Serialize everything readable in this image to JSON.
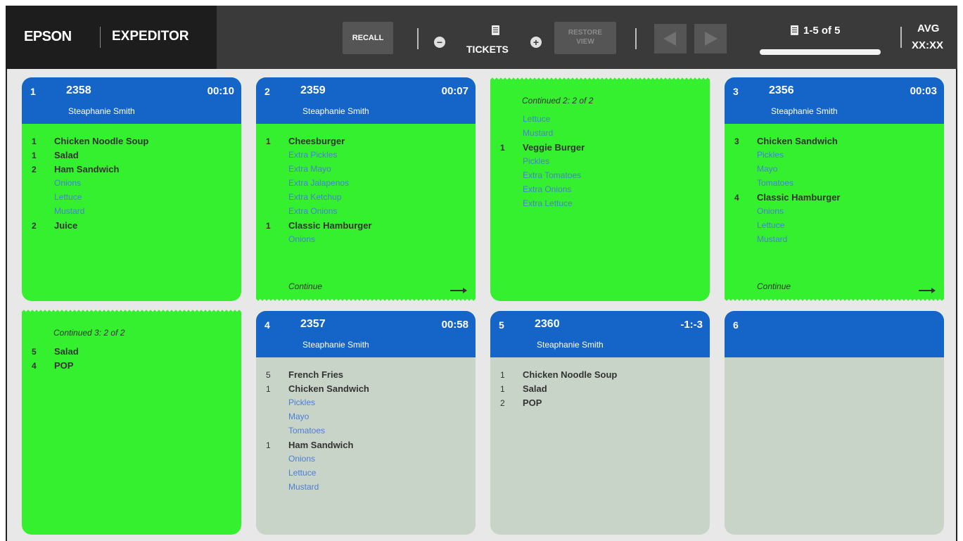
{
  "header": {
    "brand": "EPSON",
    "app_title": "EXPEDITOR",
    "recall_label": "RECALL",
    "tickets_label": "TICKETS",
    "restore_label_1": "RESTORE",
    "restore_label_2": "VIEW",
    "page_label": "1-5 of 5",
    "avg_label": "AVG",
    "avg_value": "XX:XX",
    "page_progress": 1.0
  },
  "tickets": {
    "t1": {
      "num": "1",
      "id": "2358",
      "time": "00:10",
      "name": "Steaphanie Smith",
      "items": [
        {
          "qty": "1",
          "name": "Chicken Noodle Soup",
          "mods": []
        },
        {
          "qty": "1",
          "name": "Salad",
          "mods": []
        },
        {
          "qty": "2",
          "name": "Ham Sandwich",
          "mods": [
            "Onions",
            "Lettuce",
            "Mustard"
          ]
        },
        {
          "qty": "2",
          "name": "Juice",
          "mods": []
        }
      ]
    },
    "t2": {
      "num": "2",
      "id": "2359",
      "time": "00:07",
      "name": "Steaphanie Smith",
      "items": [
        {
          "qty": "1",
          "name": "Cheesburger",
          "mods": [
            "Extra Pickles",
            "Extra Mayo",
            "Extra Jalapenos",
            "Extra Ketchup",
            "Extra Onions"
          ]
        },
        {
          "qty": "1",
          "name": "Classic Hamburger",
          "mods": [
            "Onions"
          ]
        }
      ],
      "continue": "Continue"
    },
    "t2c": {
      "label": "Continued 2: 2 of 2",
      "pre_mods": [
        "Lettuce",
        "Mustard"
      ],
      "items": [
        {
          "qty": "1",
          "name": "Veggie Burger",
          "mods": [
            "Pickles",
            "Extra Tomatoes",
            "Extra Onions",
            "Extra Lettuce"
          ]
        }
      ]
    },
    "t3": {
      "num": "3",
      "id": "2356",
      "time": "00:03",
      "name": "Steaphanie Smith",
      "items": [
        {
          "qty": "3",
          "name": "Chicken Sandwich",
          "mods": [
            "Pickles",
            "Mayo",
            "Tomatoes"
          ]
        },
        {
          "qty": "4",
          "name": "Classic Hamburger",
          "mods": [
            "Onions",
            "Lettuce",
            "Mustard"
          ]
        }
      ],
      "continue": "Continue"
    },
    "t3c": {
      "label": "Continued 3: 2 of 2",
      "items": [
        {
          "qty": "5",
          "name": "Salad"
        },
        {
          "qty": "4",
          "name": "POP"
        }
      ]
    },
    "t4": {
      "num": "4",
      "id": "2357",
      "time": "00:58",
      "name": "Steaphanie Smith",
      "items": [
        {
          "qty": "5",
          "name": "French Fries",
          "mods": []
        },
        {
          "qty": "1",
          "name": "Chicken Sandwich",
          "mods": [
            "Pickles",
            "Mayo",
            "Tomatoes"
          ]
        },
        {
          "qty": "1",
          "name": "Ham Sandwich",
          "mods": [
            "Onions",
            "Lettuce",
            "Mustard"
          ]
        }
      ]
    },
    "t5": {
      "num": "5",
      "id": "2360",
      "time": "-1:-3",
      "name": "Steaphanie Smith",
      "items": [
        {
          "qty": "1",
          "name": "Chicken Noodle Soup"
        },
        {
          "qty": "1",
          "name": "Salad"
        },
        {
          "qty": "2",
          "name": "POP"
        }
      ]
    },
    "t6": {
      "num": "6"
    }
  },
  "colors": {
    "header_blue": "#1565c9",
    "ticket_green": "#35f02e",
    "ticket_gray": "#c9d4c9",
    "modifier_text": "#4a7fd4",
    "topbar": "#3a3a3a"
  }
}
